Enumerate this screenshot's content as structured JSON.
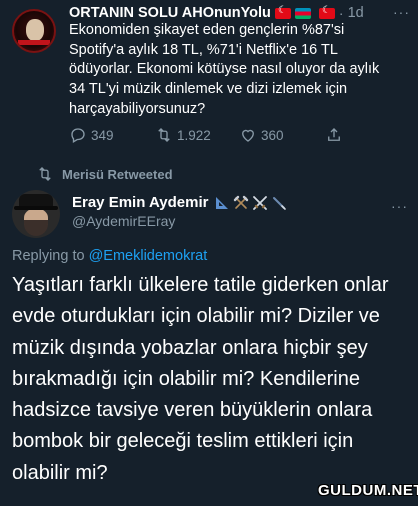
{
  "original_tweet": {
    "author_name": "ORTANIN SOLU AHOnunYolu",
    "separator": "·",
    "time": "1d",
    "more_label": "···",
    "text": "Ekonomiden şikayet eden gençlerin %87'si Spotify'a aylık 18 TL, %71'i Netflix'e 16 TL ödüyorlar. Ekonomi kötüyse nasıl oluyor da aylık 34 TL'yi müzik dinlemek ve dizi izlemek için harçayabiliyorsunuz?",
    "replies": "349",
    "retweets": "1.922",
    "likes": "360",
    "icons": [
      "reply-icon",
      "retweet-icon",
      "like-icon",
      "share-icon"
    ],
    "flags": [
      "tr",
      "az",
      "tr"
    ]
  },
  "retweet_notice": {
    "text": "Merisü Retweeted"
  },
  "reply_tweet": {
    "author_name": "Eray Emin Aydemir",
    "handle": "@AydemirEEray",
    "more_label": "···",
    "replying_prefix": "Replying to",
    "replying_to": "@Emeklidemokrat",
    "text": "Yaşıtları farklı ülkelere tatile giderken onlar evde oturdukları için olabilir mi? Diziler ve müzik dışında yobazlar onlara hiçbir şey bırakmadığı için olabilir mi? Kendilerine hadsizce tavsiye veren büyüklerin onlara bombok bir geleceği teslim ettikleri için olabilir mi?"
  },
  "watermark": "GULDUM.NET",
  "colors": {
    "background": "#15202b",
    "muted": "#8899a6",
    "link": "#1da1f2",
    "text": "#ffffff"
  }
}
